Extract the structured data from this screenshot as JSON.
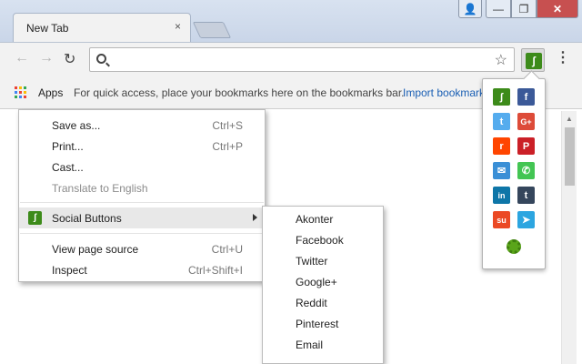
{
  "window": {
    "tab_title": "New Tab",
    "tab_close": "×",
    "user_glyph": "👤",
    "min_glyph": "—",
    "max_glyph": "❐",
    "close_glyph": "✕"
  },
  "toolbar": {
    "back": "←",
    "forward": "→",
    "reload": "↻",
    "address": "",
    "star": "☆",
    "menu": "⋮",
    "ext_logo": "ʃ"
  },
  "bookmarks": {
    "apps_label": "Apps",
    "hint": "For quick access, place your bookmarks here on the bookmarks bar.",
    "import_link": "Import bookmarks...",
    "apps_colors": [
      "#ea4335",
      "#fbbc05",
      "#34a853",
      "#4285f4",
      "#ea4335",
      "#fbbc05",
      "#34a853",
      "#4285f4",
      "#ea4335"
    ]
  },
  "context_menu": {
    "save_as": {
      "label": "Save as...",
      "shortcut": "Ctrl+S"
    },
    "print": {
      "label": "Print...",
      "shortcut": "Ctrl+P"
    },
    "cast": {
      "label": "Cast..."
    },
    "translate": {
      "label": "Translate to English"
    },
    "social": {
      "label": "Social Buttons"
    },
    "view_source": {
      "label": "View page source",
      "shortcut": "Ctrl+U"
    },
    "inspect": {
      "label": "Inspect",
      "shortcut": "Ctrl+Shift+I"
    }
  },
  "submenu": {
    "items": [
      "Akonter",
      "Facebook",
      "Twitter",
      "Google+",
      "Reddit",
      "Pinterest",
      "Email"
    ]
  },
  "social_popup": {
    "icons": [
      {
        "name": "akonter-icon",
        "glyph": "ʃ",
        "color": "#3d8b1a"
      },
      {
        "name": "facebook-icon",
        "glyph": "f",
        "color": "#3b5998"
      },
      {
        "name": "twitter-icon",
        "glyph": "t",
        "color": "#55acee"
      },
      {
        "name": "google-plus-icon",
        "glyph": "G+",
        "color": "#dd4b39"
      },
      {
        "name": "reddit-icon",
        "glyph": "r",
        "color": "#ff4500"
      },
      {
        "name": "pinterest-icon",
        "glyph": "P",
        "color": "#cb2027"
      },
      {
        "name": "email-icon",
        "glyph": "✉",
        "color": "#3a8fd6"
      },
      {
        "name": "whatsapp-icon",
        "glyph": "✆",
        "color": "#43c553"
      },
      {
        "name": "linkedin-icon",
        "glyph": "in",
        "color": "#0e76a8"
      },
      {
        "name": "tumblr-icon",
        "glyph": "t",
        "color": "#35465c"
      },
      {
        "name": "stumbleupon-icon",
        "glyph": "su",
        "color": "#eb4924"
      },
      {
        "name": "telegram-icon",
        "glyph": "➤",
        "color": "#2ca5e0"
      }
    ]
  }
}
